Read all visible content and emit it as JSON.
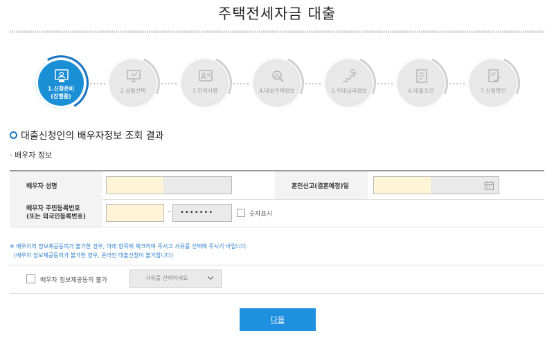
{
  "page": {
    "title": "주택전세자금 대출"
  },
  "steps": [
    {
      "label": "1.신청준비",
      "sub": "(진행중)",
      "icon": "id-card-icon",
      "active": true
    },
    {
      "label": "2.상품선택",
      "icon": "computer-icon"
    },
    {
      "label": "3.인적사항",
      "icon": "person-card-icon"
    },
    {
      "label": "4.대상주택정보",
      "icon": "house-search-icon"
    },
    {
      "label": "5.우대금리정보",
      "icon": "rate-stairs-icon"
    },
    {
      "label": "6.대출조건",
      "icon": "document-list-icon"
    },
    {
      "label": "7.신청확인",
      "icon": "confirm-document-icon"
    }
  ],
  "section": {
    "title": "대출신청인의 배우자정보 조회 결과",
    "subtitle": "· 배우자 정보"
  },
  "form": {
    "spouse_name_label": "배우자 성명",
    "marriage_date_label": "혼인신고(결혼예정)일",
    "rrn_label_line1": "배우자 주민등록번호",
    "rrn_label_line2": "(또는 외국인등록번호)",
    "rrn_separator": "-",
    "rrn_back_masked": "•••••••",
    "show_digits_label": "숫자표시"
  },
  "notice": {
    "line1": "※ 배우자의 정보제공동의가 불가한 경우, 아래 항목에 체크하여 주시고 사유를 선택해 주시기 바랍니다.",
    "line2": "(배우자 정보제공동의가 불가한 경우, 온라인 대출신청이 불가합니다)"
  },
  "consent": {
    "checkbox_label": "배우자 정보제공동의 불가",
    "select_placeholder": "사유를 선택하세요"
  },
  "buttons": {
    "next": "다음"
  },
  "colors": {
    "accent": "#1a8fd6",
    "button": "#1f8fdf",
    "notice": "#2b7fd1",
    "input_highlight": "#fff4d5"
  }
}
